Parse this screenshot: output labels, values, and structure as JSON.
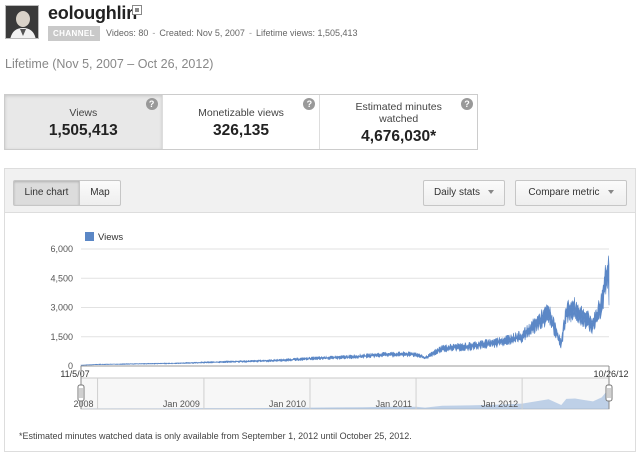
{
  "channel": {
    "name": "eoloughlin",
    "badge": "CHANNEL",
    "videos": "Videos: 80",
    "created": "Created: Nov 5, 2007",
    "lifetime_views": "Lifetime views: 1,505,413"
  },
  "period_label": "Lifetime (Nov 5, 2007 – Oct 26, 2012)",
  "metrics": [
    {
      "label": "Views",
      "value": "1,505,413",
      "active": true
    },
    {
      "label": "Monetizable views",
      "value": "326,135",
      "active": false
    },
    {
      "label": "Estimated minutes watched",
      "value": "4,676,030*",
      "active": false
    }
  ],
  "help_glyph": "?",
  "toolbar": {
    "line_chart": "Line chart",
    "map": "Map",
    "daily_stats": "Daily stats",
    "compare_metric": "Compare metric"
  },
  "colors": {
    "series": "#5b87c6",
    "navigator": "#8fb0da"
  },
  "chart_data": {
    "type": "area",
    "title": "",
    "xlabel": "",
    "ylabel": "",
    "series": [
      {
        "name": "Views"
      }
    ],
    "y_ticks": [
      "6,000",
      "4,500",
      "3,000",
      "1,500",
      "0"
    ],
    "ylim": [
      0,
      6000
    ],
    "x_start_label": "11/5/07",
    "x_end_label": "10/26/12",
    "x_range": [
      "2007-11-05",
      "2012-10-26"
    ],
    "points": [
      {
        "x": "2007-11-05",
        "y": 40
      },
      {
        "x": "2008-01-01",
        "y": 80
      },
      {
        "x": "2008-04-01",
        "y": 100
      },
      {
        "x": "2008-07-01",
        "y": 120
      },
      {
        "x": "2008-10-01",
        "y": 140
      },
      {
        "x": "2009-01-01",
        "y": 180
      },
      {
        "x": "2009-04-01",
        "y": 220
      },
      {
        "x": "2009-07-01",
        "y": 250
      },
      {
        "x": "2009-10-01",
        "y": 300
      },
      {
        "x": "2010-01-01",
        "y": 380
      },
      {
        "x": "2010-04-01",
        "y": 430
      },
      {
        "x": "2010-07-01",
        "y": 500
      },
      {
        "x": "2010-10-01",
        "y": 600
      },
      {
        "x": "2011-01-01",
        "y": 600
      },
      {
        "x": "2011-02-01",
        "y": 400
      },
      {
        "x": "2011-04-01",
        "y": 900
      },
      {
        "x": "2011-07-01",
        "y": 1000
      },
      {
        "x": "2011-10-01",
        "y": 1200
      },
      {
        "x": "2012-01-01",
        "y": 1500
      },
      {
        "x": "2012-02-01",
        "y": 1900
      },
      {
        "x": "2012-03-01",
        "y": 2300
      },
      {
        "x": "2012-04-01",
        "y": 2700
      },
      {
        "x": "2012-05-15",
        "y": 1100
      },
      {
        "x": "2012-06-01",
        "y": 2800
      },
      {
        "x": "2012-07-01",
        "y": 2900
      },
      {
        "x": "2012-08-01",
        "y": 2500
      },
      {
        "x": "2012-09-01",
        "y": 2100
      },
      {
        "x": "2012-10-01",
        "y": 3200
      },
      {
        "x": "2012-10-15",
        "y": 4600
      },
      {
        "x": "2012-10-26",
        "y": 5200
      }
    ],
    "navigator_labels": [
      "2008",
      "Jan 2009",
      "Jan 2010",
      "Jan 2011",
      "Jan 2012"
    ],
    "grid": true,
    "legend_position": "top-left"
  },
  "footnote": "*Estimated minutes watched data is only available from September 1, 2012 until October 25, 2012."
}
